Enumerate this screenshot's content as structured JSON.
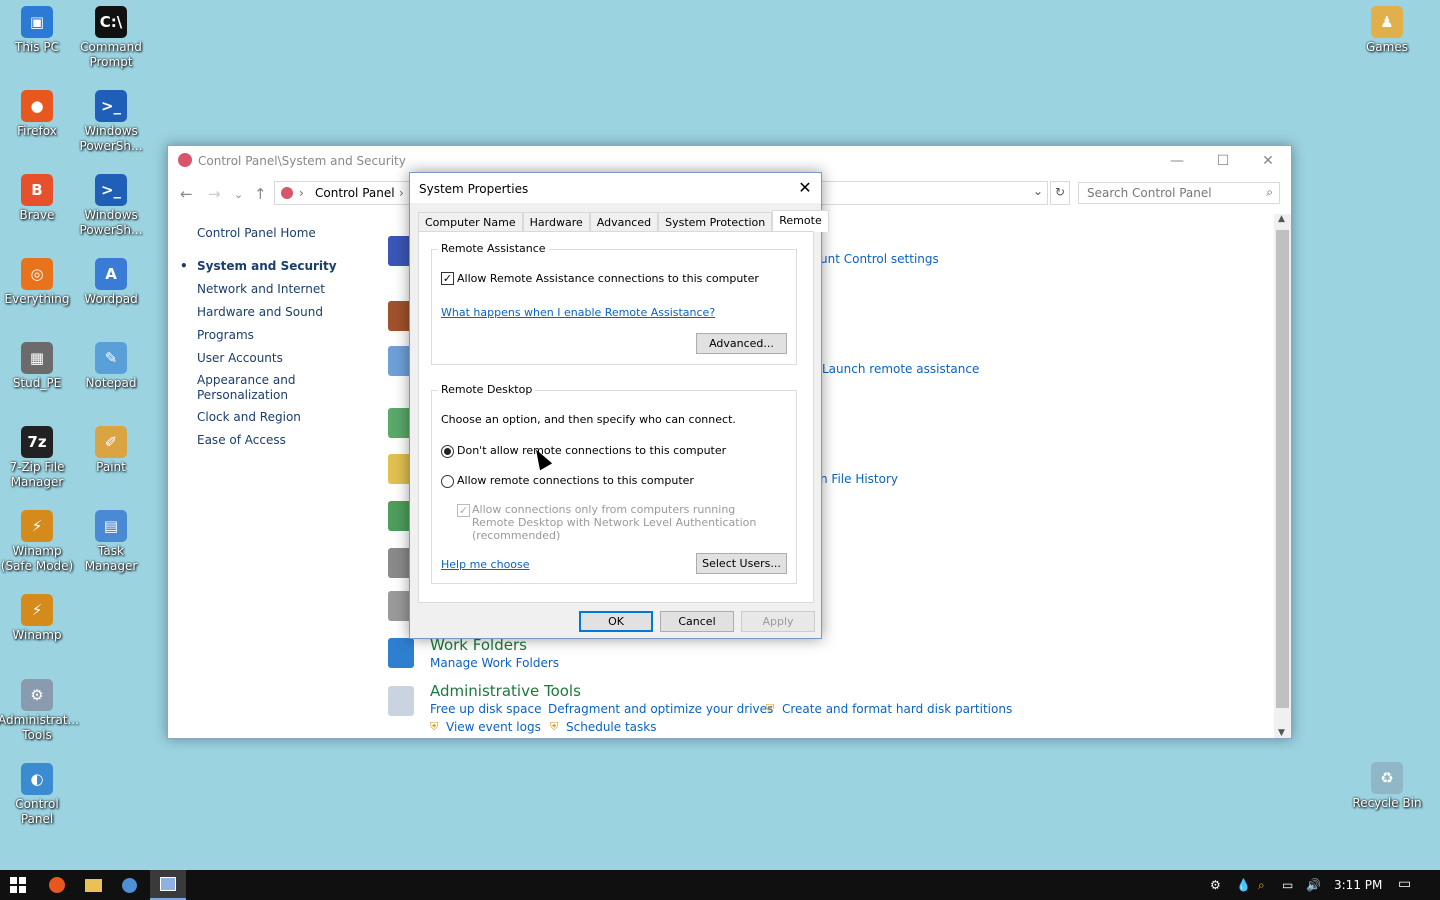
{
  "desktop": {
    "icons": [
      {
        "label": "This PC",
        "color": "#2b7bd6",
        "glyph": "▣",
        "icon": "computer-icon"
      },
      {
        "label": "Command Prompt",
        "color": "#111111",
        "glyph": "C:\\",
        "icon": "terminal-icon"
      },
      {
        "label": "Firefox",
        "color": "#e8571e",
        "glyph": "●",
        "icon": "firefox-icon"
      },
      {
        "label": "Windows PowerSh...",
        "color": "#1f5fb8",
        "glyph": ">_",
        "icon": "powershell-icon"
      },
      {
        "label": "Brave",
        "color": "#e6502a",
        "glyph": "B",
        "icon": "brave-icon"
      },
      {
        "label": "Windows PowerSh...",
        "color": "#1f5fb8",
        "glyph": ">_",
        "icon": "powershell-icon"
      },
      {
        "label": "Everything",
        "color": "#e9721c",
        "glyph": "◎",
        "icon": "search-magnifier-icon"
      },
      {
        "label": "Wordpad",
        "color": "#3a7bd5",
        "glyph": "A",
        "icon": "wordpad-icon"
      },
      {
        "label": "Stud_PE",
        "color": "#6b6b6b",
        "glyph": "▦",
        "icon": "building-icon"
      },
      {
        "label": "Notepad",
        "color": "#5aa0d8",
        "glyph": "✎",
        "icon": "notepad-icon"
      },
      {
        "label": "7-Zip File Manager",
        "color": "#222222",
        "glyph": "7z",
        "icon": "archive-icon"
      },
      {
        "label": "Paint",
        "color": "#d9a441",
        "glyph": "✐",
        "icon": "paint-icon"
      },
      {
        "label": "Winamp (Safe Mode)",
        "color": "#d58b1b",
        "glyph": "⚡",
        "icon": "winamp-icon"
      },
      {
        "label": "Task Manager",
        "color": "#4a8ad4",
        "glyph": "▤",
        "icon": "task-manager-icon"
      },
      {
        "label": "Winamp",
        "color": "#d58b1b",
        "glyph": "⚡",
        "icon": "winamp-icon"
      },
      {
        "label": "Administrat... Tools",
        "color": "#8a9bb0",
        "glyph": "⚙",
        "icon": "admin-tools-icon"
      },
      {
        "label": "Control Panel",
        "color": "#3b8bd0",
        "glyph": "◐",
        "icon": "control-panel-icon"
      }
    ],
    "right_icons": [
      {
        "label": "Games",
        "color": "#e2b04a",
        "glyph": "♟",
        "icon": "games-folder-icon"
      },
      {
        "label": "Recycle Bin",
        "color": "#8fb7c7",
        "glyph": "♻",
        "icon": "recycle-bin-icon"
      }
    ]
  },
  "control_panel": {
    "title": "Control Panel\\System and Security",
    "breadcrumb": "Control Panel",
    "search_placeholder": "Search Control Panel",
    "nav": [
      "Control Panel Home",
      "System and Security",
      "Network and Internet",
      "Hardware and Sound",
      "Programs",
      "User Accounts",
      "Appearance and Personalization",
      "Clock and Region",
      "Ease of Access"
    ],
    "partial_links": {
      "uac": "unt Control settings",
      "remote_assist": "Launch remote assistance",
      "file_history": "n File History"
    },
    "work_folders": {
      "title": "Work Folders",
      "link": "Manage Work Folders"
    },
    "admin_tools": {
      "title": "Administrative Tools",
      "links": [
        "Free up disk space",
        "Defragment and optimize your drives",
        "Create and format hard disk partitions",
        "View event logs",
        "Schedule tasks"
      ]
    }
  },
  "dialog": {
    "title": "System Properties",
    "tabs": [
      "Computer Name",
      "Hardware",
      "Advanced",
      "System Protection",
      "Remote"
    ],
    "remote_assistance": {
      "group_label": "Remote Assistance",
      "allow_label": "Allow Remote Assistance connections to this computer",
      "allow_checked": true,
      "help_link": "What happens when I enable Remote Assistance?",
      "advanced_button": "Advanced..."
    },
    "remote_desktop": {
      "group_label": "Remote Desktop",
      "instruction": "Choose an option, and then specify who can connect.",
      "option_dont_allow": "Don't allow remote connections to this computer",
      "option_allow": "Allow remote connections to this computer",
      "selected": "dont_allow",
      "nla_label": "Allow connections only from computers running Remote Desktop with Network Level Authentication (recommended)",
      "help_link": "Help me choose",
      "select_users_button": "Select Users..."
    },
    "buttons": {
      "ok": "OK",
      "cancel": "Cancel",
      "apply": "Apply"
    }
  },
  "taskbar": {
    "clock": "3:11 PM"
  }
}
